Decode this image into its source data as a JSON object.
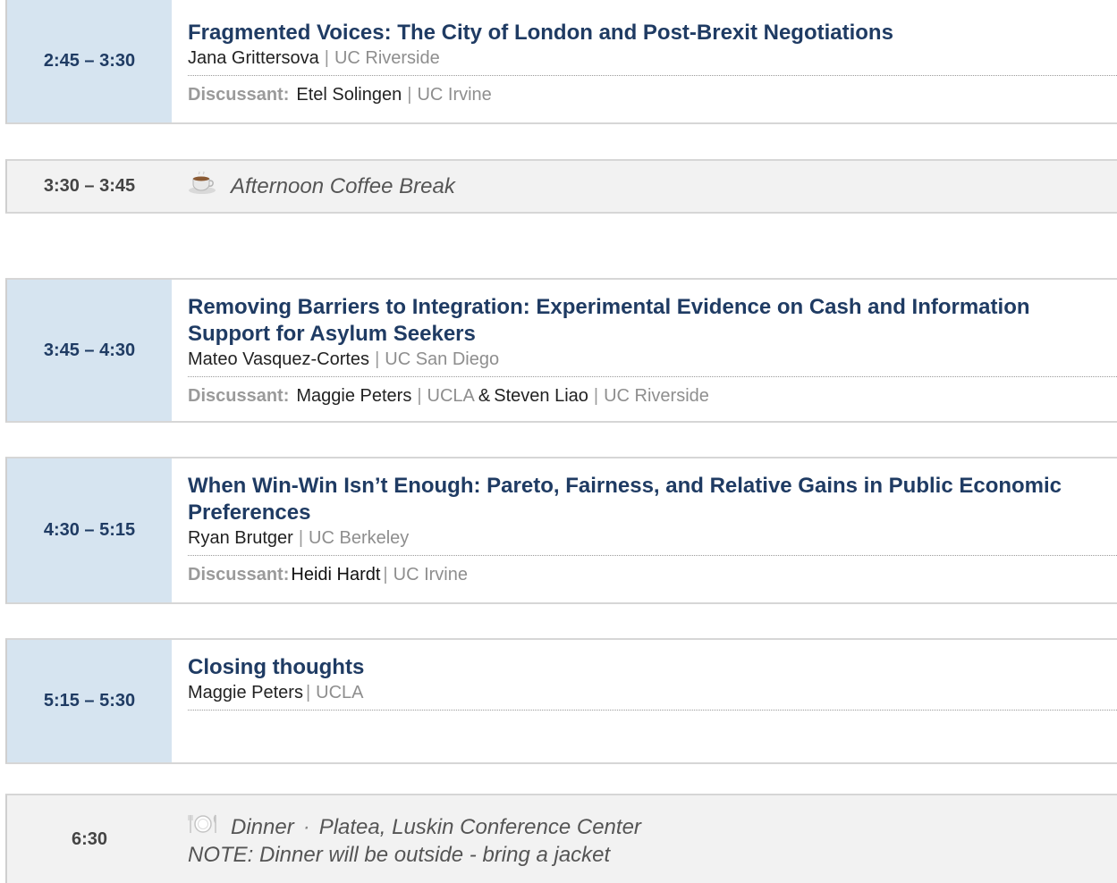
{
  "sessions": [
    {
      "time": "2:45 – 3:30",
      "title": "Fragmented Voices: The City of London and Post-Brexit Negotiations",
      "presenter": {
        "name": "Jana Grittersova",
        "affiliation": "UC Riverside"
      },
      "discussant_label": "Discussant:",
      "discussants": [
        {
          "name": "Etel Solingen",
          "affiliation": "UC Irvine"
        }
      ],
      "separator": "|"
    },
    {
      "time": "3:45 – 4:30",
      "title": "Removing Barriers to Integration: Experimental Evidence on Cash and Information Support for Asylum Seekers",
      "presenter": {
        "name": "Mateo Vasquez-Cortes",
        "affiliation": "UC San Diego"
      },
      "discussant_label": "Discussant:",
      "discussants": [
        {
          "name": "Maggie Peters",
          "affiliation": "UCLA"
        },
        {
          "name": "Steven Liao",
          "affiliation": "UC Riverside"
        }
      ],
      "conjunction": "&",
      "separator": "|"
    },
    {
      "time": "4:30 – 5:15",
      "title": "When Win-Win Isn’t Enough: Pareto, Fairness, and Relative Gains in Public Economic Preferences",
      "presenter": {
        "name": "Ryan Brutger",
        "affiliation": "UC Berkeley"
      },
      "discussant_label": "Discussant:",
      "discussants": [
        {
          "name": "Heidi Hardt",
          "affiliation": "UC Irvine"
        }
      ],
      "separator": "|"
    },
    {
      "time": "5:15 – 5:30",
      "title": "Closing thoughts",
      "presenter": {
        "name": "Maggie Peters",
        "affiliation": "UCLA"
      },
      "separator": "|"
    }
  ],
  "coffee_break": {
    "time": "3:30 – 3:45",
    "icon": "coffee-cup-icon",
    "label": "Afternoon Coffee Break"
  },
  "dinner": {
    "time": "6:30",
    "icon": "plate-cutlery-icon",
    "label": "Dinner",
    "dot": "·",
    "venue": "Platea, Luskin Conference Center",
    "note": "NOTE: Dinner will be outside - bring a jacket"
  },
  "colors": {
    "title_blue": "#1f3b63",
    "time_bg": "#d6e4f0",
    "break_bg": "#f2f2f2",
    "muted_gray": "#8e8e8e"
  }
}
